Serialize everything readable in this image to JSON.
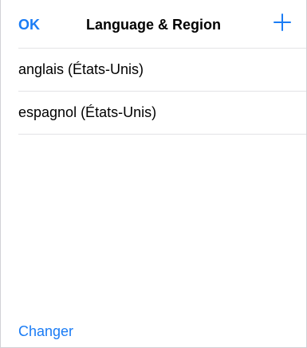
{
  "navbar": {
    "ok_label": "OK",
    "title": "Language & Region",
    "add_icon": "plus-icon"
  },
  "languages": [
    {
      "label": "anglais (États-Unis)"
    },
    {
      "label": "espagnol (États-Unis)"
    }
  ],
  "footer": {
    "change_label": "Changer"
  },
  "colors": {
    "accent": "#1a7cf5",
    "separator": "#e3e3e6"
  }
}
